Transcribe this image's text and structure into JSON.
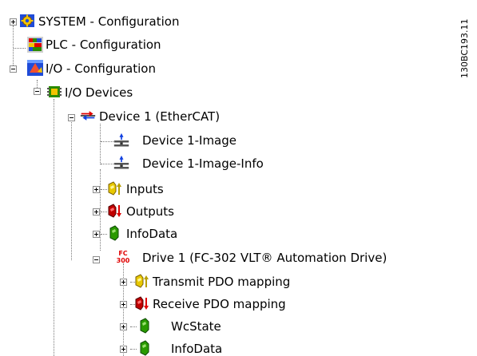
{
  "tree": {
    "nodes": [
      {
        "id": "system",
        "label": "SYSTEM - Configuration",
        "icon": "system-config-icon",
        "toggle": "plus"
      },
      {
        "id": "plc",
        "label": "PLC - Configuration",
        "icon": "plc-config-icon",
        "toggle": "none"
      },
      {
        "id": "io",
        "label": "I/O - Configuration",
        "icon": "io-config-icon",
        "toggle": "minus"
      },
      {
        "id": "io-devices",
        "label": "I/O Devices",
        "icon": "io-devices-icon",
        "toggle": "minus"
      },
      {
        "id": "device1",
        "label": "Device 1 (EtherCAT)",
        "icon": "ethercat-device-icon",
        "toggle": "minus"
      },
      {
        "id": "device1-image",
        "label": "Device 1-Image",
        "icon": "process-image-icon",
        "toggle": "none"
      },
      {
        "id": "device1-image-info",
        "label": "Device 1-Image-Info",
        "icon": "process-image-icon",
        "toggle": "none"
      },
      {
        "id": "inputs",
        "label": "Inputs",
        "icon": "inputs-icon",
        "toggle": "plus"
      },
      {
        "id": "outputs",
        "label": "Outputs",
        "icon": "outputs-icon",
        "toggle": "plus"
      },
      {
        "id": "infodata",
        "label": "InfoData",
        "icon": "infodata-icon",
        "toggle": "plus"
      },
      {
        "id": "drive1",
        "label": "Drive 1 (FC-302 VLT® Automation Drive)",
        "icon": "fc300-drive-icon",
        "toggle": "minus"
      },
      {
        "id": "transmit-pdo",
        "label": "Transmit PDO mapping",
        "icon": "inputs-icon",
        "toggle": "plus"
      },
      {
        "id": "receive-pdo",
        "label": "Receive PDO mapping",
        "icon": "outputs-icon",
        "toggle": "plus"
      },
      {
        "id": "wcstate",
        "label": "WcState",
        "icon": "infodata-icon",
        "toggle": "plus"
      },
      {
        "id": "drive-infodata",
        "label": "InfoData",
        "icon": "infodata-icon",
        "toggle": "plus"
      }
    ],
    "fc_icon_text": {
      "top": "FC",
      "bottom": "300"
    }
  },
  "watermark": {
    "text": "130BC193.11"
  },
  "colors": {
    "input_arrow": "#b8a000",
    "output_arrow": "#e00000",
    "fc_text": "#e00000",
    "bus_arrow_red": "#e00000",
    "bus_arrow_blue": "#1040e0"
  }
}
